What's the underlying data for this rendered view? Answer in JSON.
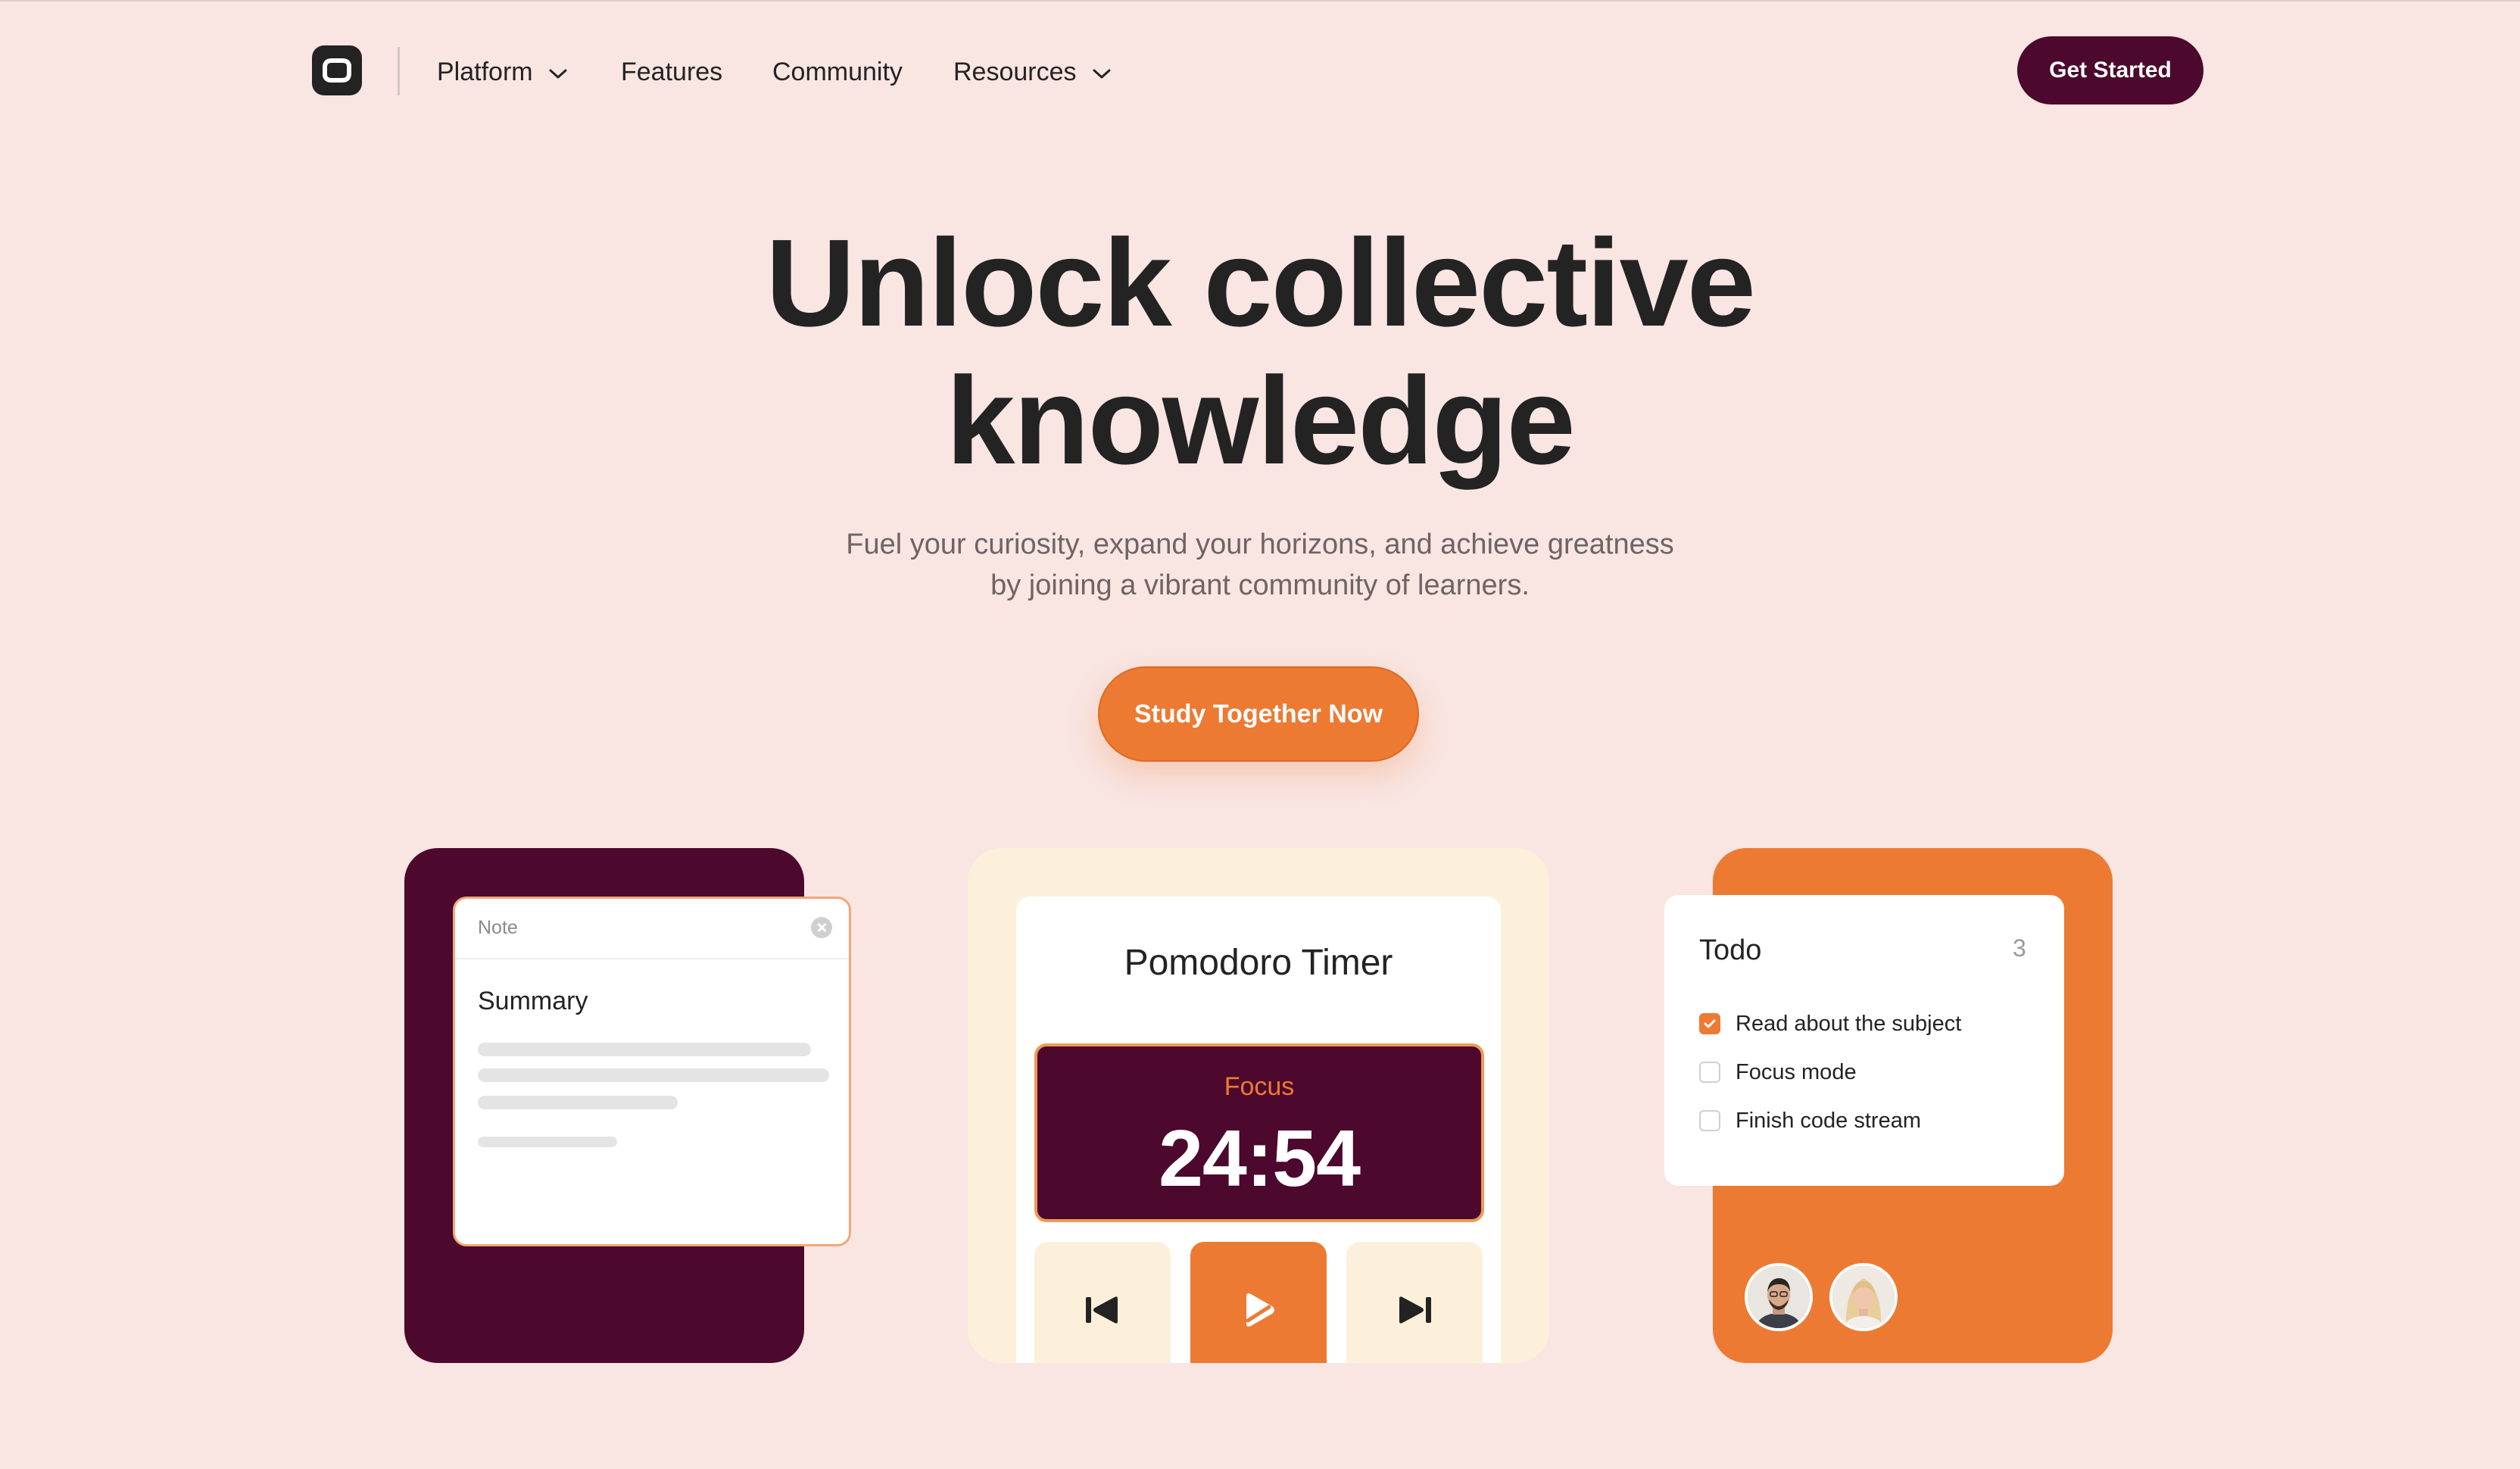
{
  "nav": {
    "logo_icon": "logo-icon",
    "items": [
      {
        "label": "Platform",
        "has_dropdown": true
      },
      {
        "label": "Features",
        "has_dropdown": false
      },
      {
        "label": "Community",
        "has_dropdown": false
      },
      {
        "label": "Resources",
        "has_dropdown": true
      }
    ],
    "cta_label": "Get Started"
  },
  "hero": {
    "title_line1": "Unlock collective",
    "title_line2": "knowledge",
    "subtitle_line1": "Fuel your curiosity, expand your horizons, and achieve greatness",
    "subtitle_line2": "by joining a vibrant community of learners.",
    "cta_label": "Study Together Now"
  },
  "note_card": {
    "header_label": "Note",
    "title": "Summary"
  },
  "pomodoro": {
    "title": "Pomodoro Timer",
    "mode": "Focus",
    "time": "24:54",
    "controls": [
      "previous-icon",
      "play-icon",
      "next-icon"
    ]
  },
  "todo": {
    "title": "Todo",
    "count": "3",
    "items": [
      {
        "label": "Read about the subject",
        "checked": true
      },
      {
        "label": "Focus mode",
        "checked": false
      },
      {
        "label": "Finish code stream",
        "checked": false
      }
    ]
  },
  "colors": {
    "background": "#f9e5e2",
    "brand_dark": "#4c082d",
    "accent": "#ed7a33",
    "cream": "#fdf0da",
    "text": "#232323"
  }
}
